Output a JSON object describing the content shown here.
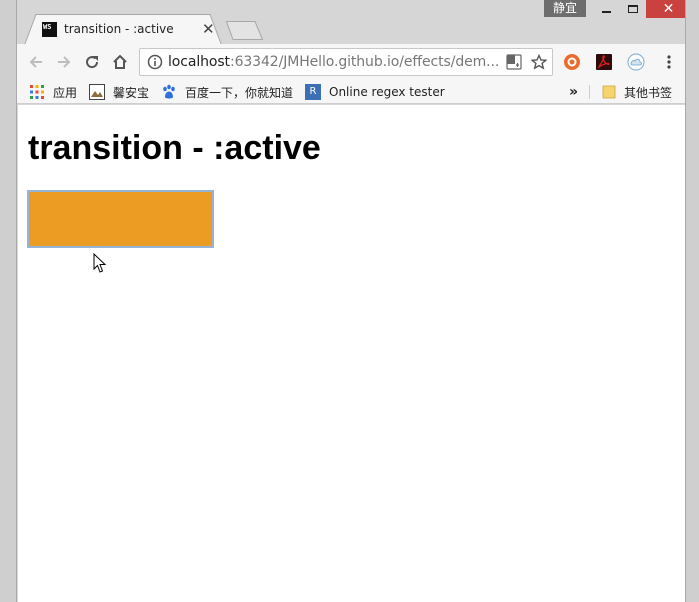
{
  "window": {
    "user_label": "静宜",
    "close_glyph": "✕"
  },
  "tab": {
    "title": "transition - :active",
    "favicon_text": "WS",
    "close_glyph": "✕"
  },
  "toolbar": {
    "url_host": "localhost",
    "url_rest": ":63342/JMHello.github.io/effects/dem..."
  },
  "bookmarks": {
    "items": [
      {
        "label": "应用",
        "icon": "apps-grid-icon"
      },
      {
        "label": "馨安宝",
        "icon": "image-icon"
      },
      {
        "label": "百度一下，你就知道",
        "icon": "baidu-paw-icon"
      },
      {
        "label": "Online regex tester",
        "icon": "regex-r-icon",
        "icon_text": "R"
      }
    ],
    "overflow": "»",
    "other_label": "其他书签"
  },
  "page": {
    "heading": "transition - :active",
    "box_color": "#ec9c22",
    "box_border": "#95b4d8"
  }
}
